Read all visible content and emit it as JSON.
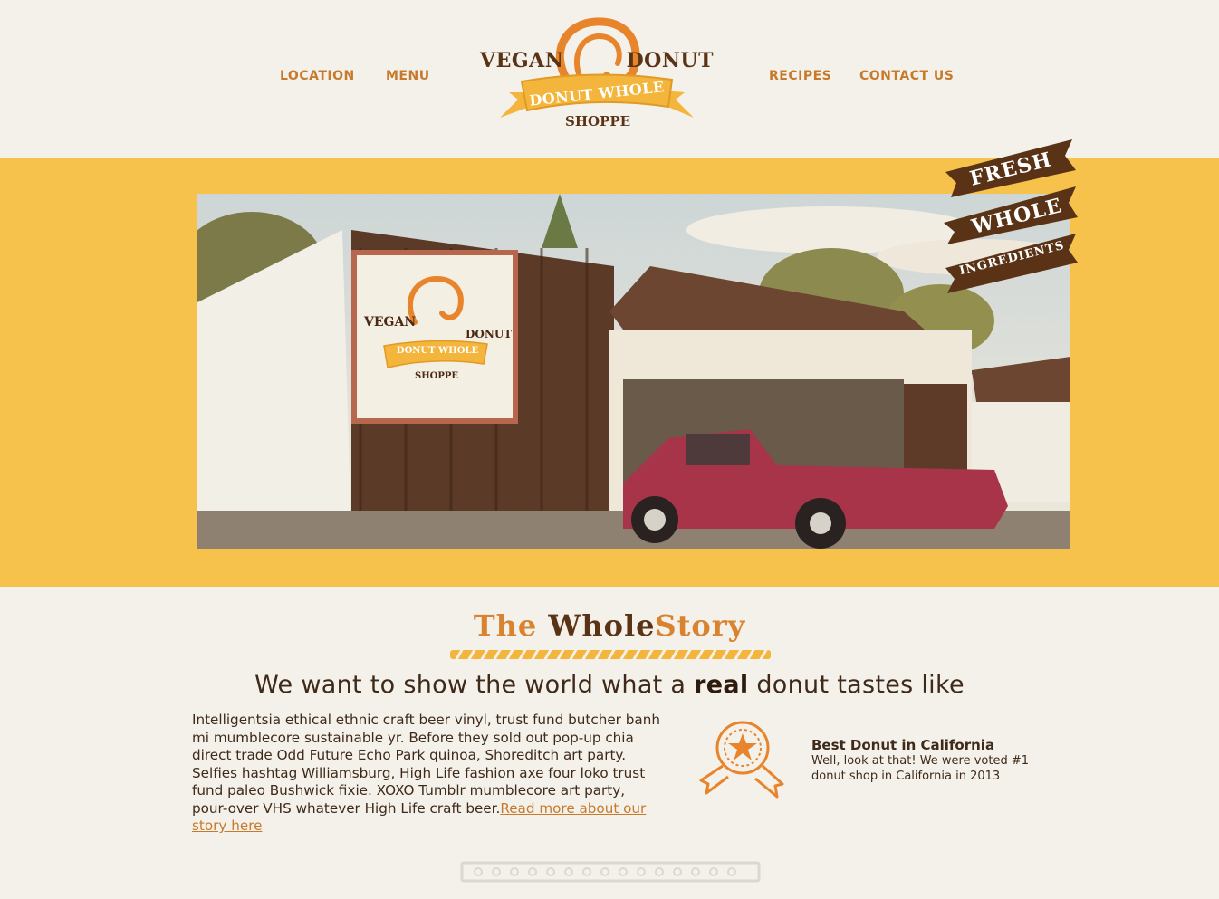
{
  "nav": {
    "left": [
      "LOCATION",
      "MENU"
    ],
    "right": [
      "RECIPES",
      "CONTACT US"
    ]
  },
  "logo": {
    "word_left": "VEGAN",
    "word_right": "DONUT",
    "ribbon": "DONUT WHOLE",
    "sub": "SHOPPE"
  },
  "hero": {
    "sign": {
      "word_left": "VEGAN",
      "word_right": "DONUT",
      "ribbon": "DONUT WHOLE",
      "sub": "SHOPPE"
    },
    "stamp": [
      "FRESH",
      "WHOLE",
      "INGREDIENTS"
    ]
  },
  "story": {
    "title_part1": "The ",
    "title_part2": "Whole",
    "title_part3": "Story",
    "tagline_pre": "We want to show the world what a ",
    "tagline_bold": "real",
    "tagline_post": " donut tastes like",
    "body": "Intelligentsia ethical ethnic craft beer vinyl, trust fund butcher banh mi mumblecore sustainable yr. Before they sold out pop-up chia direct trade Odd Future Echo Park quinoa, Shoreditch art party. Selfies hashtag Williamsburg, High Life fashion axe four loko trust fund paleo Bushwick fixie. XOXO Tumblr mumblecore art party, pour-over VHS whatever High Life craft beer.",
    "read_more": "Read more about our story here"
  },
  "award": {
    "title": "Best Donut in California",
    "text": "Well, look at that! We were voted #1 donut shop in California in 2013"
  },
  "colors": {
    "brand_orange": "#d9822f",
    "brand_brown": "#5a3316",
    "hero_yellow": "#f6c24b",
    "background": "#f3f1ea"
  }
}
